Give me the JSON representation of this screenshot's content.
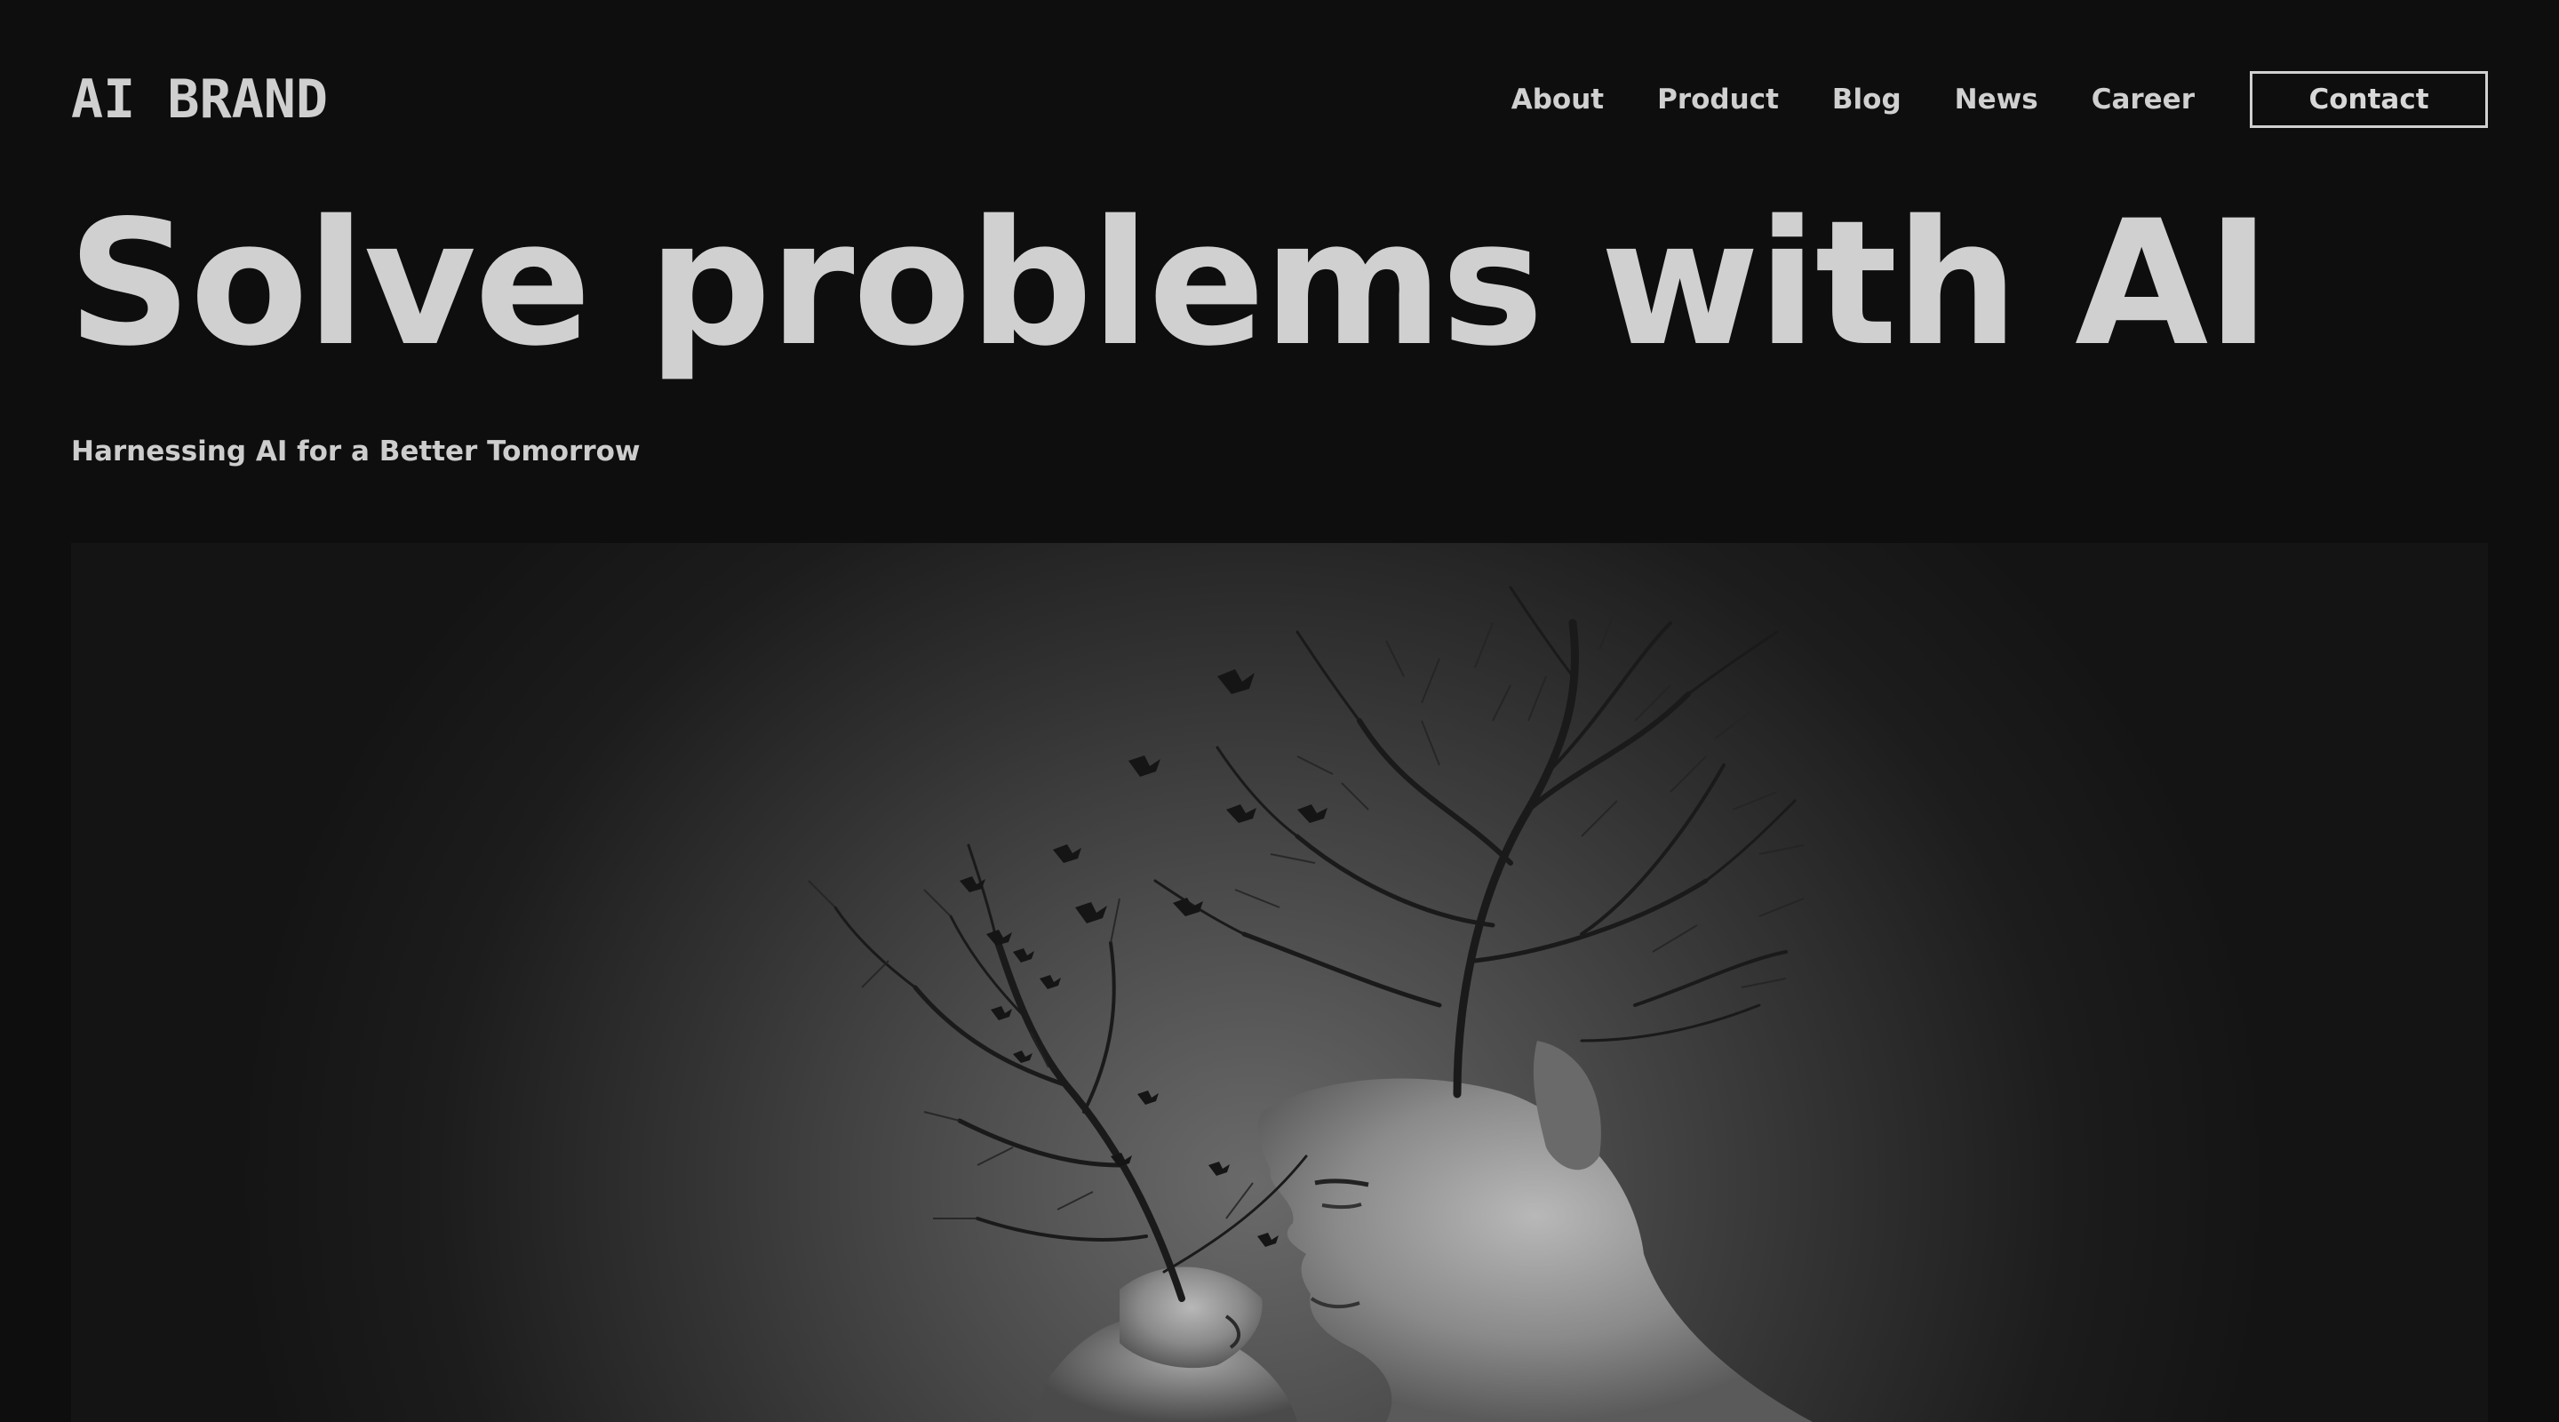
{
  "header": {
    "logo": "AI BRAND",
    "nav": [
      {
        "label": "About"
      },
      {
        "label": "Product"
      },
      {
        "label": "Blog"
      },
      {
        "label": "News"
      },
      {
        "label": "Career"
      }
    ],
    "contact_label": "Contact"
  },
  "hero": {
    "title": "Solve problems with AI",
    "subtitle": "Harnessing AI for a Better Tomorrow",
    "image": {
      "subject": "two-profiles-with-tree-branches-and-birds",
      "style": "black-and-white"
    }
  },
  "colors": {
    "background": "#0e0e0e",
    "text": "#d0d0d0",
    "border": "#d0d0d0"
  }
}
